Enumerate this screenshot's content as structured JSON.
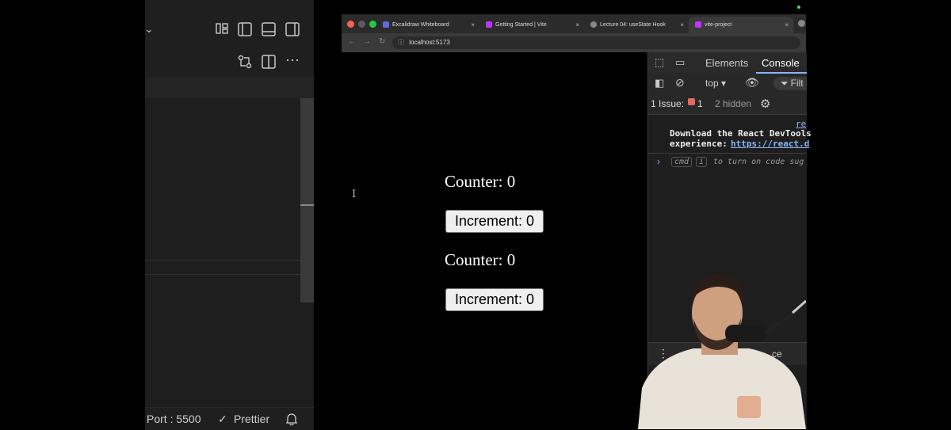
{
  "editor": {
    "status_port": "Port : 5500",
    "status_prettier": "Prettier",
    "icons": [
      "chevron-down-icon",
      "layout-icon",
      "sidebar-left-icon",
      "panel-bottom-icon",
      "sidebar-right-icon",
      "compare-changes-icon",
      "split-editor-icon",
      "more-icon",
      "bell-icon",
      "double-check-icon"
    ]
  },
  "browser": {
    "tabs": [
      {
        "label": "Excalidraw Whiteboard",
        "close": "×"
      },
      {
        "label": "Getting Started | Vite",
        "close": "×"
      },
      {
        "label": "Lecture 04: useState Hook",
        "close": "×"
      },
      {
        "label": "vite-project",
        "close": "×"
      }
    ],
    "url": "localhost:5173",
    "nav": {
      "back": "←",
      "forward": "→",
      "reload": "↻"
    }
  },
  "page": {
    "counter1": "Counter: 0",
    "button1": "Increment: 0",
    "counter2": "Counter: 0",
    "button2": "Increment: 0"
  },
  "devtools": {
    "tab_elements": "Elements",
    "tab_console": "Console",
    "context": "top",
    "filter_label": "Filt",
    "issues_label": "1 Issue:",
    "issues_count": "1",
    "hidden_label": "2 hidden",
    "log_link_top": "re",
    "log_line1": "Download the React DevTools",
    "log_line2_prefix": "experience:",
    "log_link": "https://react.d",
    "prompt_cmd": "cmd",
    "prompt_i": "i",
    "prompt_hint": "to turn on code sug",
    "drawer_partial": "ce"
  },
  "colors": {
    "editor_bg": "#1f1f1f",
    "devtools_bg": "#1e1e1e",
    "link": "#8ab4f8",
    "badge_red": "#e46962",
    "button_bg": "#efefef"
  }
}
